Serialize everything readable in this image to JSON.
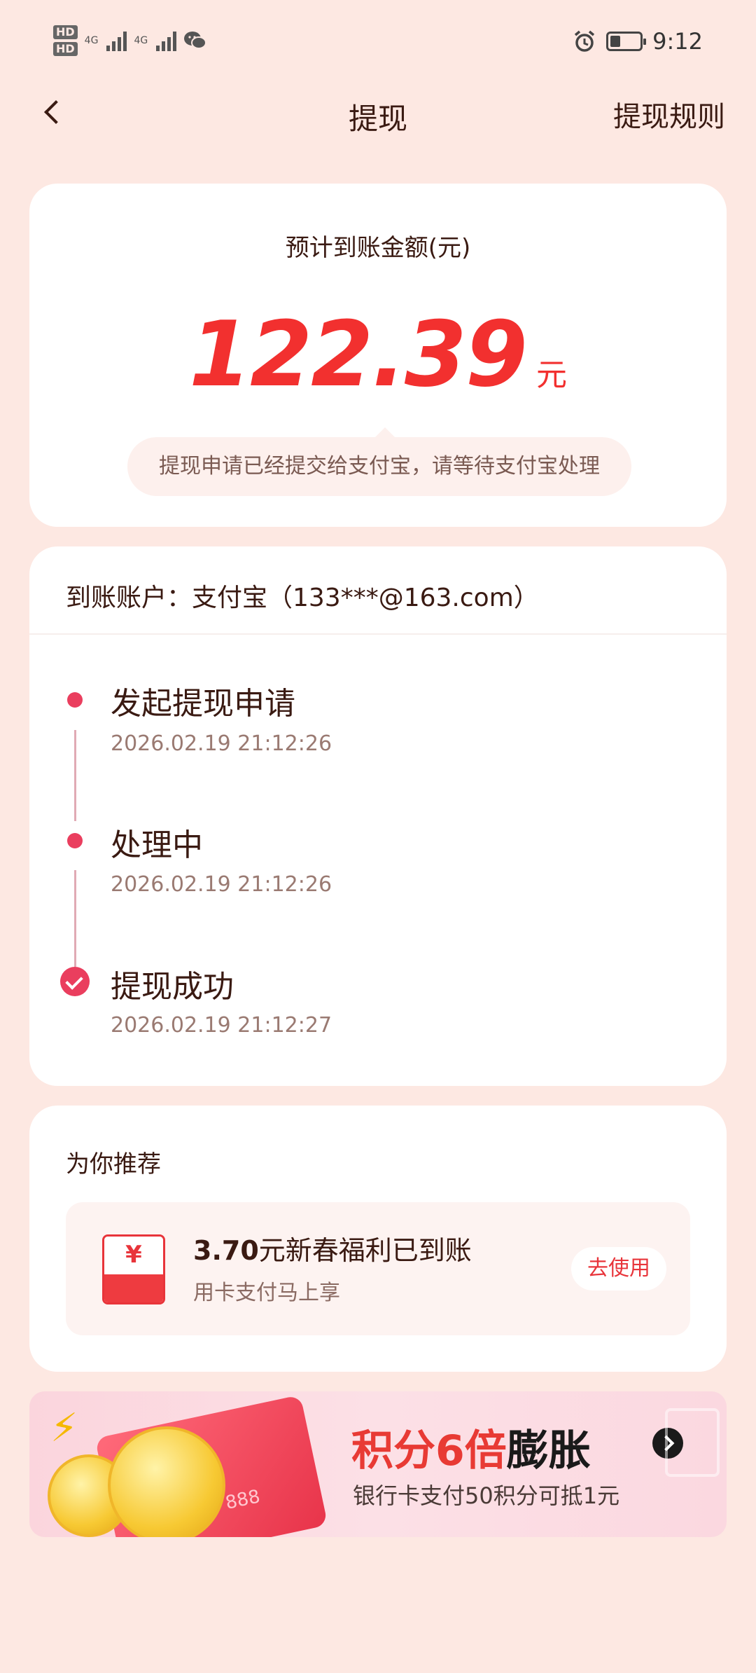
{
  "status_bar": {
    "hd1": "HD",
    "hd2": "HD",
    "net1": "4G",
    "net2": "4G",
    "time": "9:12",
    "icons": [
      "wechat-icon",
      "alarm-icon",
      "battery-icon"
    ]
  },
  "nav": {
    "title": "提现",
    "right_label": "提现规则"
  },
  "amount": {
    "label": "预计到账金额(元)",
    "value": "122.39",
    "unit": "元",
    "tip": "提现申请已经提交给支付宝，请等待支付宝处理"
  },
  "progress": {
    "account": "到账账户：支付宝（133***@163.com）",
    "steps": [
      {
        "title": "发起提现申请",
        "time": "2026.02.19 21:12:26"
      },
      {
        "title": "处理中",
        "time": "2026.02.19 21:12:26"
      },
      {
        "title": "提现成功",
        "time": "2026.02.19 21:12:27"
      }
    ]
  },
  "recommend": {
    "title": "为你推荐",
    "item": {
      "amount": "3.70",
      "text": "元新春福利已到账",
      "sub": "用卡支付马上享",
      "button": "去使用",
      "icon_glyph": "¥"
    }
  },
  "banner": {
    "title_red1": "积分",
    "title_red2": "6倍",
    "title_dark": "膨胀",
    "subtitle": "银行卡支付50积分可抵1元",
    "card_digits": "888"
  },
  "colors": {
    "background": "#fde8e2",
    "accent_red": "#f2302f",
    "timeline_pink": "#ea3e5e"
  }
}
